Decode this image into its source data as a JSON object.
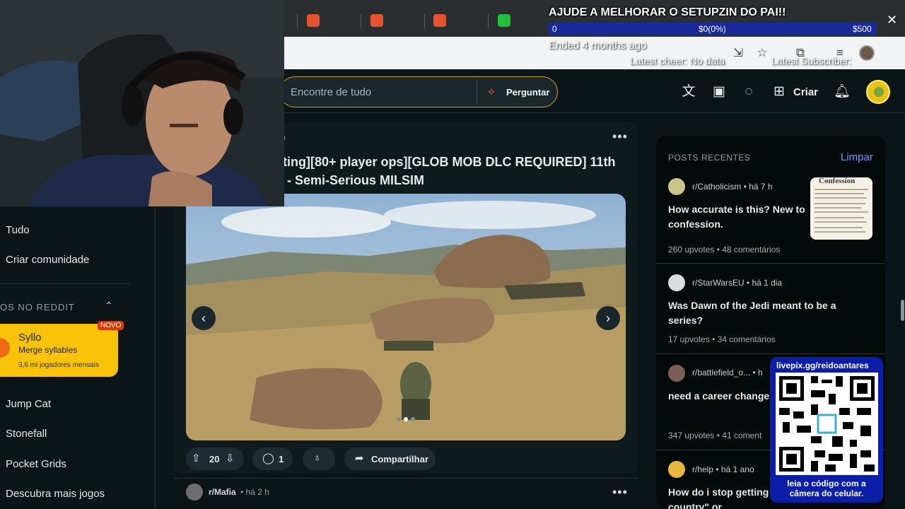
{
  "browser": {
    "tab_icons": [
      "bookmark-icon",
      "bookmark-icon",
      "bookmark-icon",
      "kick-icon"
    ],
    "toolbar_icons": [
      "install-icon",
      "star-icon",
      "extensions-icon",
      "media-icon",
      "profile-avatar"
    ]
  },
  "overlay": {
    "title": "AJUDE A MELHORAR O SETUPZIN DO PAI!!",
    "goal_start": "0",
    "goal_progress": "$0(0%)",
    "goal_end": "$500",
    "goal_fraction": 0,
    "ended": "Ended 4 months ago",
    "latest_cheer": "Latest cheer: No data",
    "latest_subscriber": "Latest Subscriber:"
  },
  "header": {
    "search_placeholder": "Encontre de tudo",
    "ask_label": "Perguntar",
    "create_label": "Criar",
    "icons": [
      "translate-icon",
      "ads-icon",
      "chat-icon",
      "plus-icon",
      "bell-icon"
    ]
  },
  "left_sidebar": {
    "nav_top": [
      "Tudo",
      "Criar comunidade"
    ],
    "section_title": "OS NO REDDIT",
    "featured_game": {
      "title": "Syllo",
      "subtitle": "Merge syllables",
      "meta": "3,6 mi jogadores mensais",
      "badge": "NOVO"
    },
    "games": [
      "Jump Cat",
      "Stonefall",
      "Pocket Grids",
      "Descubra mais jogos"
    ]
  },
  "post": {
    "time": "h",
    "title_line1": "ting][80+ player ops][GLOB MOB DLC REQUIRED] 11th",
    "title_line2": "- Semi-Serious MILSIM",
    "upvotes": "20",
    "comments": "1",
    "share_label": "Compartilhar",
    "gallery_index": 1,
    "gallery_count": 3
  },
  "next_post": {
    "subreddit": "r/Mafia",
    "time": "• há 2 h"
  },
  "recent_posts": {
    "title": "POSTS RECENTES",
    "clear_label": "Limpar",
    "thumbnail_heading": "Confession",
    "items": [
      {
        "subreddit": "r/Catholicism",
        "time": "• há 7 h",
        "title": "How accurate is this? New to confession.",
        "upvotes": "260 upvotes",
        "comments": "• 48 comentários",
        "avatar_color": "#c9c48a"
      },
      {
        "subreddit": "r/StarWarsEU",
        "time": "• há 1 dia",
        "title": "Was Dawn of the Jedi meant to be a series?",
        "upvotes": "17 upvotes",
        "comments": "• 34 comentários",
        "avatar_color": "#d9dde0"
      },
      {
        "subreddit": "r/battlefield_o...",
        "time": "• h",
        "title": "need a career change",
        "upvotes": "347 upvotes",
        "comments": "• 41 coment",
        "avatar_color": "#7a5f58"
      },
      {
        "subreddit": "r/help",
        "time": "• há 1 ano",
        "title": "How do i stop getting you/popular in your country\" or",
        "upvotes": "",
        "comments": "",
        "avatar_color": "#e9b83f"
      }
    ]
  },
  "qr": {
    "url": "livepix.gg/reidoantares",
    "caption1": "leia o código com a",
    "caption2": "câmera do celular."
  }
}
